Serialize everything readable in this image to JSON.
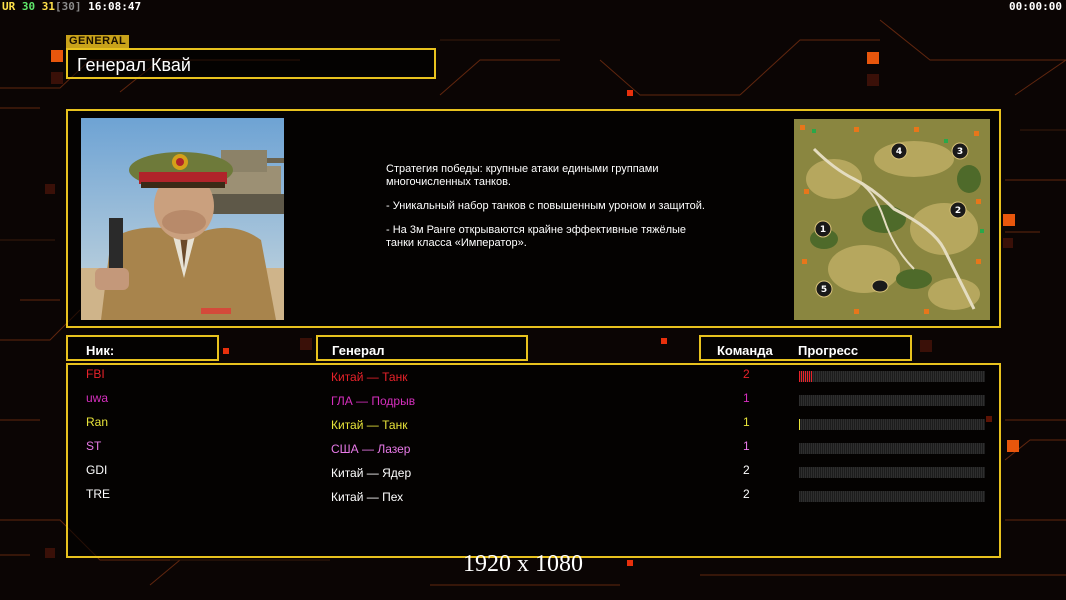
{
  "hud": {
    "ur": "UR",
    "fps_a": "30",
    "fps_b": "31",
    "fps_c": "[30]",
    "clock": "16:08:47",
    "timer": "00:00:00"
  },
  "section_tag": "GENERAL",
  "general_name": "Генерал Квай",
  "description": [
    "Стратегия победы: крупные атаки едиными группами многочисленных танков.",
    "- Уникальный набор танков с повышенным уроном и защитой.",
    "- На 3м Ранге открываются крайне эффективные тяжёлые танки класса «Император»."
  ],
  "minimap": {
    "spawns": [
      "4",
      "3",
      "2",
      "1",
      "5"
    ]
  },
  "table_headers": {
    "nick": "Ник:",
    "general": "Генерал",
    "team": "Команда",
    "progress": "Прогресс"
  },
  "players": [
    {
      "nick": "FBI",
      "general": "Китай — Танк",
      "team": "2",
      "color": "#e8222a",
      "progress": 0.07
    },
    {
      "nick": "uwa",
      "general": "ГЛА — Подрыв",
      "team": "1",
      "color": "#d62fbe",
      "progress": 0.0
    },
    {
      "nick": "Ran",
      "general": "Китай — Танк",
      "team": "1",
      "color": "#e8e43a",
      "progress": 0.01
    },
    {
      "nick": "ST",
      "general": "США — Лазер",
      "team": "1",
      "color": "#e87ae8",
      "progress": 0.0
    },
    {
      "nick": "GDI",
      "general": "Китай — Ядер",
      "team": "2",
      "color": "#ffffff",
      "progress": 0.0
    },
    {
      "nick": "TRE",
      "general": "Китай — Пех",
      "team": "2",
      "color": "#ffffff",
      "progress": 0.0
    }
  ],
  "resolution_label": "1920 x 1080",
  "colors": {
    "accent": "#e8c21e",
    "circuit": "#e8420c",
    "background": "#0b0504"
  }
}
